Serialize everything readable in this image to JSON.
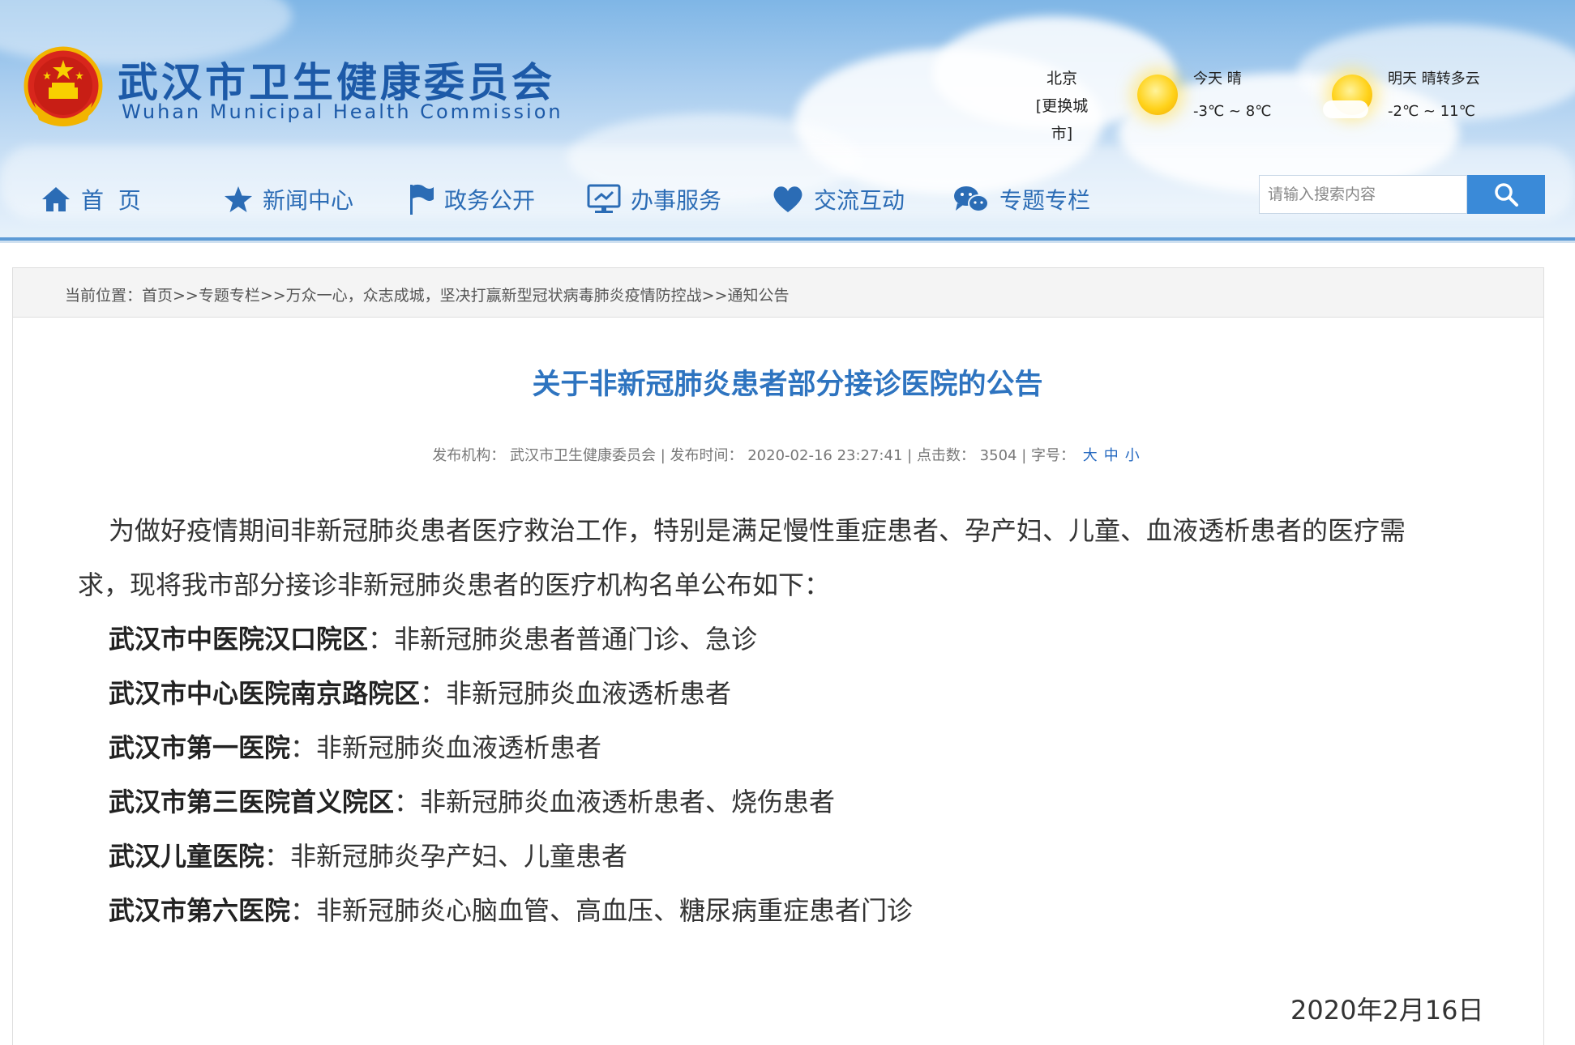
{
  "header": {
    "title": "武汉市卫生健康委员会",
    "subtitle": "Wuhan Municipal Health Commission"
  },
  "weather": {
    "city": "北京",
    "change_city": "[更换城市]",
    "today_label": "今天 晴",
    "today_temp": "-3℃ ~ 8℃",
    "tomorrow_label": "明天 晴转多云",
    "tomorrow_temp": "-2℃ ~ 11℃"
  },
  "nav": {
    "items": [
      {
        "label": "首  页",
        "icon": "home-icon"
      },
      {
        "label": "新闻中心",
        "icon": "star-icon"
      },
      {
        "label": "政务公开",
        "icon": "flag-icon"
      },
      {
        "label": "办事服务",
        "icon": "monitor-icon"
      },
      {
        "label": "交流互动",
        "icon": "heart-icon"
      },
      {
        "label": "专题专栏",
        "icon": "chat-icon"
      }
    ]
  },
  "search": {
    "placeholder": "请输入搜索内容"
  },
  "breadcrumb": "当前位置：首页>>专题专栏>>万众一心，众志成城，坚决打赢新型冠状病毒肺炎疫情防控战>>通知公告",
  "article": {
    "title": "关于非新冠肺炎患者部分接诊医院的公告",
    "meta": {
      "publisher_label": "发布机构：",
      "publisher": "武汉市卫生健康委员会",
      "time_label": "发布时间：",
      "time": "2020-02-16 23:27:41",
      "clicks_label": "点击数：",
      "clicks": "3504",
      "fontsize_label": "字号：",
      "size_large": "大",
      "size_medium": "中",
      "size_small": "小"
    },
    "intro_line1": "为做好疫情期间非新冠肺炎患者医疗救治工作，特别是满足慢性重症患者、孕产妇、儿童、血液透析患者的医疗需",
    "intro_line2": "求，现将我市部分接诊非新冠肺炎患者的医疗机构名单公布如下：",
    "hospitals": [
      {
        "name": "武汉市中医院汉口院区",
        "desc": "：非新冠肺炎患者普通门诊、急诊"
      },
      {
        "name": "武汉市中心医院南京路院区",
        "desc": "：非新冠肺炎血液透析患者"
      },
      {
        "name": "武汉市第一医院",
        "desc": "：非新冠肺炎血液透析患者"
      },
      {
        "name": "武汉市第三医院首义院区",
        "desc": "：非新冠肺炎血液透析患者、烧伤患者"
      },
      {
        "name": "武汉儿童医院",
        "desc": "：非新冠肺炎孕产妇、儿童患者"
      },
      {
        "name": "武汉市第六医院",
        "desc": "：非新冠肺炎心脑血管、高血压、糖尿病重症患者门诊"
      }
    ],
    "date": "2020年2月16日"
  },
  "colors": {
    "brand_blue": "#1d5aa8",
    "title_blue": "#2e74c0",
    "search_button": "#3a8ad8"
  }
}
